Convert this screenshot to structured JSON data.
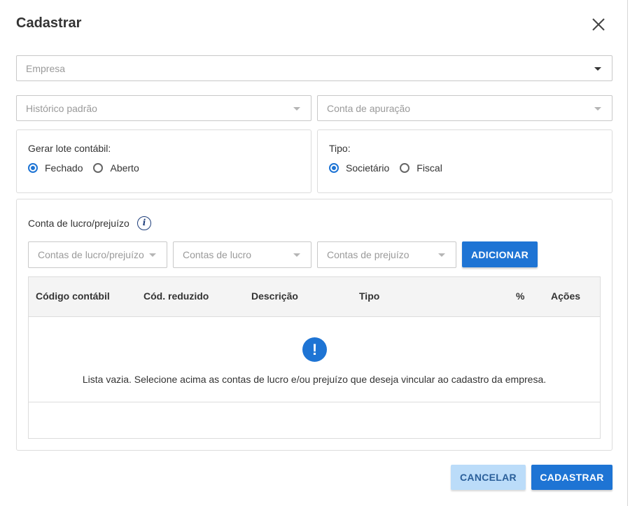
{
  "dialog": {
    "title": "Cadastrar",
    "close_icon": "close-icon"
  },
  "fields": {
    "empresa": "Empresa",
    "historico_padrao": "Histórico padrão",
    "conta_apuracao": "Conta de apuração"
  },
  "lote": {
    "label": "Gerar lote contábil:",
    "options": [
      "Fechado",
      "Aberto"
    ],
    "selected": "Fechado"
  },
  "tipo": {
    "label": "Tipo:",
    "options": [
      "Societário",
      "Fiscal"
    ],
    "selected": "Societário"
  },
  "lucro_prejuizo": {
    "label": "Conta de lucro/prejuízo",
    "info_icon": "i",
    "selects": [
      "Contas de lucro/prejuízo",
      "Contas de lucro",
      "Contas de prejuízo"
    ],
    "add_button": "ADICIONAR"
  },
  "table": {
    "columns": [
      "Código contábil",
      "Cód. reduzido",
      "Descrição",
      "Tipo",
      "%",
      "Ações"
    ],
    "empty_icon": "!",
    "empty_message": "Lista vazia. Selecione acima as contas de lucro e/ou prejuízo que deseja vincular ao cadastro da empresa."
  },
  "footer": {
    "cancel": "CANCELAR",
    "submit": "CADASTRAR"
  },
  "colors": {
    "primary": "#1e74d4",
    "primary_light": "#bbdcf9"
  }
}
